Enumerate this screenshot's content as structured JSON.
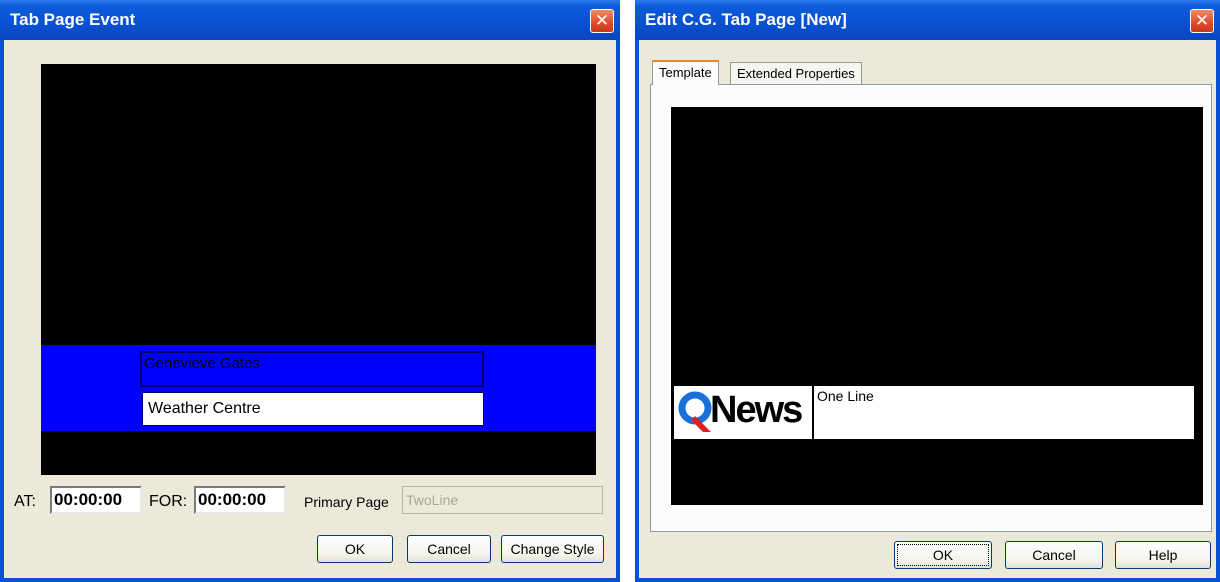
{
  "tab_page_event": {
    "title": "Tab Page Event",
    "close_glyph": "✕",
    "line1_text": "Genevieve Gates",
    "line2_text": "Weather Centre",
    "at_label": "AT:",
    "at_value": "00:00:00",
    "for_label": "FOR:",
    "for_value": "00:00:00",
    "primary_page_label": "Primary Page",
    "primary_page_value": "TwoLine",
    "ok_label": "OK",
    "cancel_label": "Cancel",
    "change_style_label": "Change Style"
  },
  "edit_cg_tab_page": {
    "title": "Edit C.G. Tab Page [New]",
    "close_glyph": "✕",
    "tabs": [
      {
        "label": "Template",
        "active": true
      },
      {
        "label": "Extended Properties",
        "active": false
      }
    ],
    "logo_text": "News",
    "line_text": "One Line",
    "ok_label": "OK",
    "cancel_label": "Cancel",
    "help_label": "Help"
  }
}
